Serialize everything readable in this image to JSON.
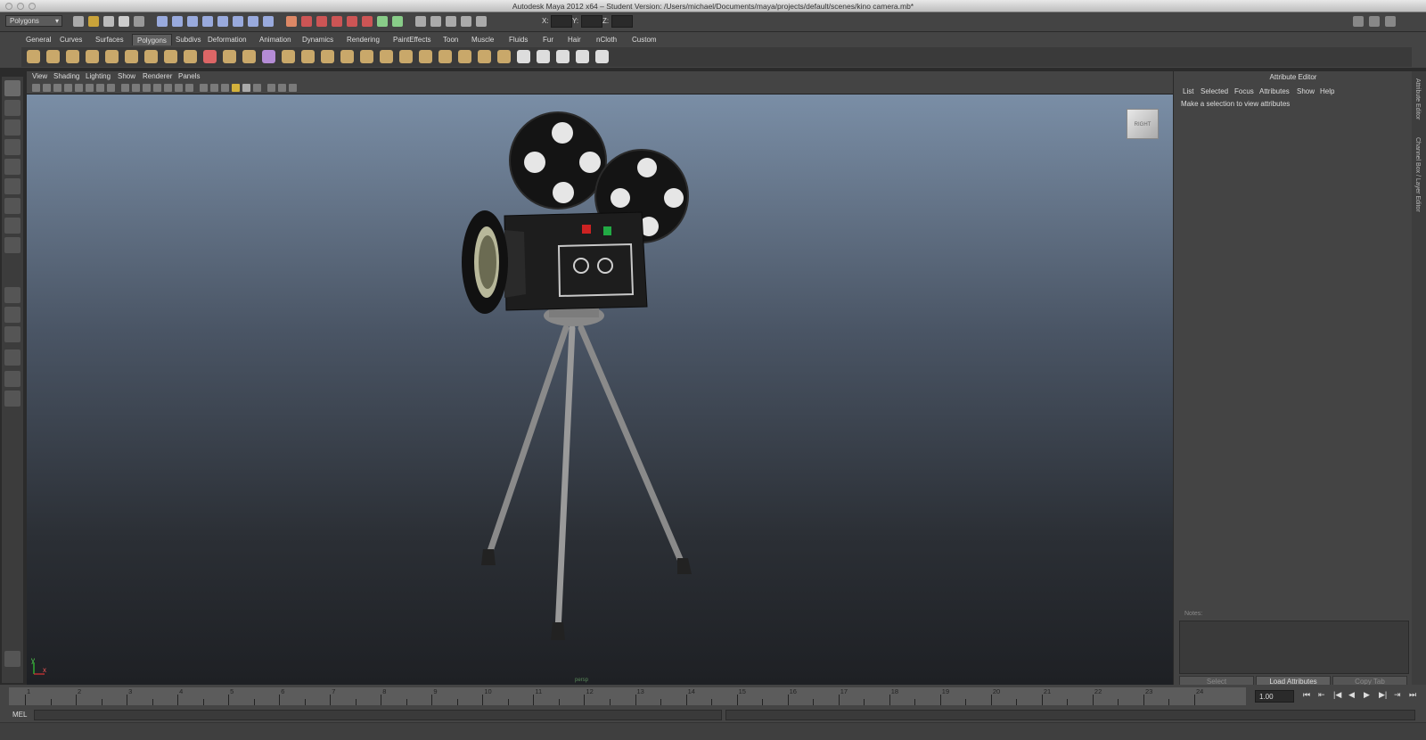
{
  "window": {
    "title": "Autodesk Maya 2012 x64 – Student Version: /Users/michael/Documents/maya/projects/default/scenes/kino camera.mb*"
  },
  "status_line": {
    "mode_selector": "Polygons",
    "coord_labels": [
      "X:",
      "Y:",
      "Z:"
    ]
  },
  "shelf": {
    "tabs": [
      "General",
      "Curves",
      "Surfaces",
      "Polygons",
      "Subdivs",
      "Deformation",
      "Animation",
      "Dynamics",
      "Rendering",
      "PaintEffects",
      "Toon",
      "Muscle",
      "Fluids",
      "Fur",
      "Hair",
      "nCloth",
      "Custom"
    ],
    "active_tab": "Polygons"
  },
  "panel": {
    "menus": [
      "View",
      "Shading",
      "Lighting",
      "Show",
      "Renderer",
      "Panels"
    ],
    "viewcube_label": "RIGHT",
    "axis_labels": {
      "y": "y",
      "x": "x"
    },
    "camera_label": "persp"
  },
  "attribute_editor": {
    "title": "Attribute Editor",
    "menus": [
      "List",
      "Selected",
      "Focus",
      "Attributes",
      "Show",
      "Help"
    ],
    "message": "Make a selection to view attributes",
    "notes_label": "Notes:",
    "buttons": {
      "select": "Select",
      "load": "Load Attributes",
      "copy": "Copy Tab"
    }
  },
  "side_tabs": [
    "Attribute Editor",
    "Channel Box / Layer Editor"
  ],
  "time_slider": {
    "ticks": [
      "1",
      "2",
      "3",
      "4",
      "5",
      "6",
      "7",
      "8",
      "9",
      "10",
      "11",
      "12",
      "13",
      "14",
      "15",
      "16",
      "17",
      "18",
      "19",
      "20",
      "21",
      "22",
      "23",
      "24"
    ],
    "current_frame": "1.00",
    "playback_icons": [
      "⏮",
      "⇤",
      "|◀",
      "◀",
      "▶",
      "▶|",
      "⇥",
      "⏭"
    ]
  },
  "command_line": {
    "label": "MEL"
  },
  "colors": {
    "ui_bg": "#444444",
    "viewport_top": "#7a8ea6",
    "viewport_bottom": "#1e2024",
    "active_red": "#cc2222",
    "active_green": "#22aa44"
  }
}
